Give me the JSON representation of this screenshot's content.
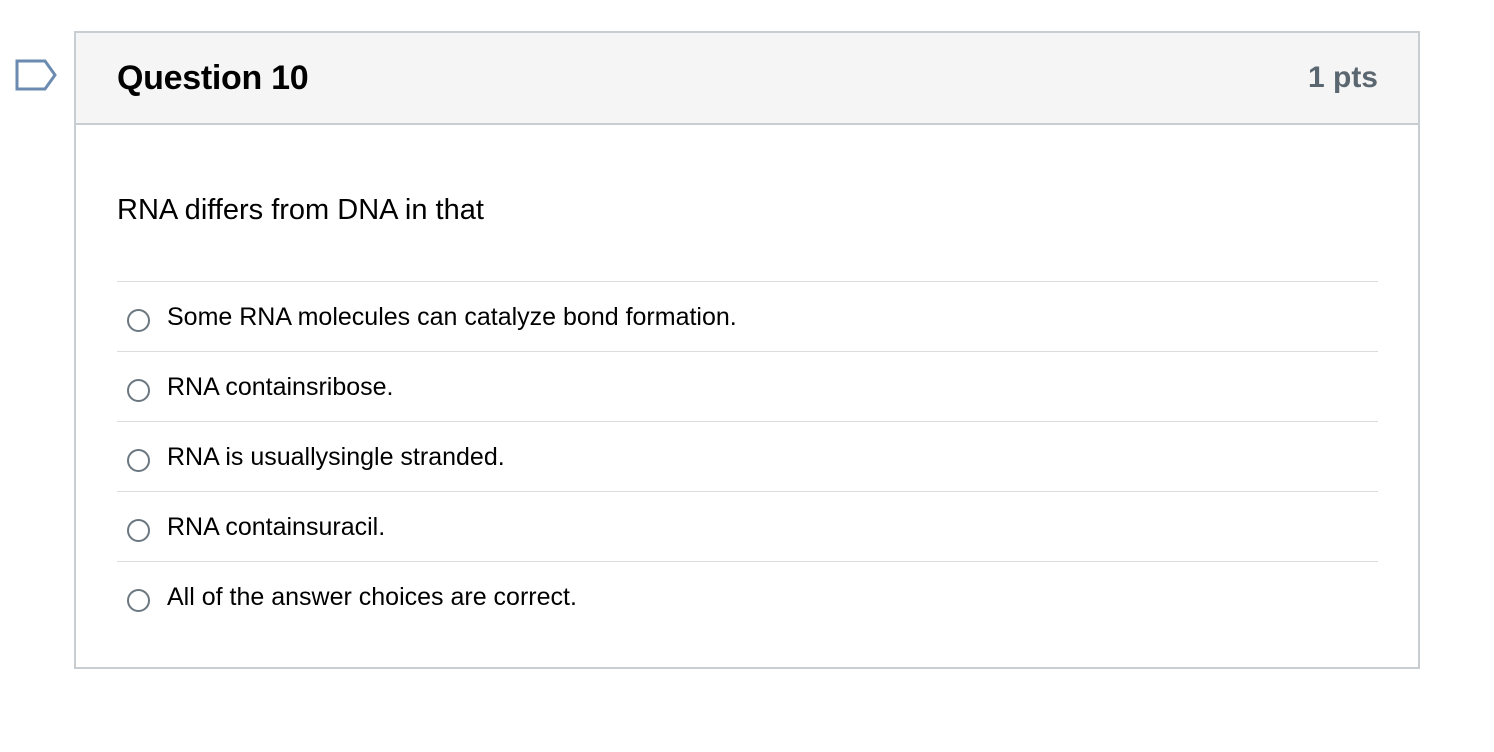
{
  "question": {
    "title": "Question 10",
    "points": "1 pts",
    "text": "RNA differs from DNA in that",
    "answers": [
      {
        "label": "Some RNA molecules can catalyze bond formation.",
        "selected": false
      },
      {
        "label": "RNA containsribose.",
        "selected": false
      },
      {
        "label": "RNA is usuallysingle stranded.",
        "selected": false
      },
      {
        "label": "RNA containsuracil.",
        "selected": false
      },
      {
        "label": "All of the answer choices are correct.",
        "selected": false
      }
    ]
  },
  "icons": {
    "flag": "bookmark-flag-icon"
  },
  "colors": {
    "header_bg": "#f5f5f5",
    "border": "#c7cdd1",
    "flag_stroke": "#6b8bb0"
  }
}
